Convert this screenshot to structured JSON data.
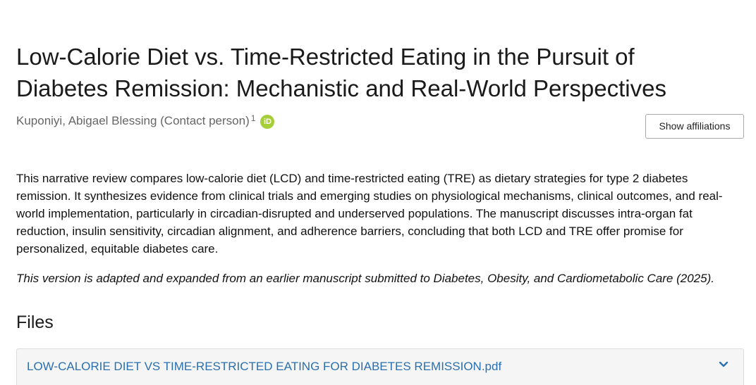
{
  "title": "Low-Calorie Diet vs. Time-Restricted Eating in the Pursuit of Diabetes Remission: Mechanistic and Real-World Perspectives",
  "author": {
    "name": "Kuponiyi, Abigael Blessing (Contact person)",
    "affiliation_marker": "1",
    "orcid_label": "iD"
  },
  "affiliations_button": "Show affiliations",
  "abstract": "This narrative review compares low-calorie diet (LCD) and time-restricted eating (TRE) as dietary strategies for type 2 diabetes remission. It synthesizes evidence from clinical trials and emerging studies on physiological mechanisms, clinical outcomes, and real-world implementation, particularly in circadian-disrupted and underserved populations. The manuscript discusses intra-organ fat reduction, insulin sensitivity, circadian alignment, and adherence barriers, concluding that both LCD and TRE offer promise for personalized, equitable diabetes care.",
  "note": "This version is adapted and expanded from an earlier manuscript submitted to Diabetes, Obesity, and Cardiometabolic Care (2025).",
  "files": {
    "heading": "Files",
    "items": [
      {
        "name": "LOW-CALORIE DIET VS TIME-RESTRICTED EATING FOR DIABETES REMISSION.pdf"
      }
    ]
  },
  "colors": {
    "link": "#2a6fb0",
    "orcid": "#a6ce39",
    "muted_text": "#666666"
  },
  "icons": {
    "orcid": "orcid-icon",
    "expand": "chevron-down-icon"
  }
}
